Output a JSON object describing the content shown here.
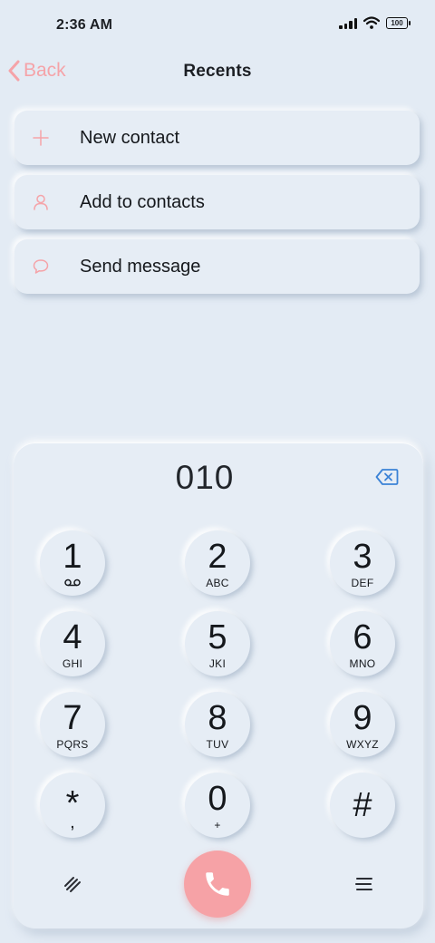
{
  "status_bar": {
    "time": "2:36 AM",
    "battery": "100"
  },
  "header": {
    "back_label": "Back",
    "title": "Recents"
  },
  "actions": [
    {
      "label": "New contact",
      "icon": "plus-icon"
    },
    {
      "label": "Add to contacts",
      "icon": "person-icon"
    },
    {
      "label": "Send message",
      "icon": "chat-bubble-icon"
    }
  ],
  "dialpad": {
    "number": "010",
    "keys": [
      {
        "digit": "1",
        "letters": ""
      },
      {
        "digit": "2",
        "letters": "ABC"
      },
      {
        "digit": "3",
        "letters": "DEF"
      },
      {
        "digit": "4",
        "letters": "GHI"
      },
      {
        "digit": "5",
        "letters": "JKI"
      },
      {
        "digit": "6",
        "letters": "MNO"
      },
      {
        "digit": "7",
        "letters": "PQRS"
      },
      {
        "digit": "8",
        "letters": "TUV"
      },
      {
        "digit": "9",
        "letters": "WXYZ"
      },
      {
        "digit": "*",
        "letters": ","
      },
      {
        "digit": "0",
        "letters": "+"
      },
      {
        "digit": "#",
        "letters": ""
      }
    ]
  },
  "colors": {
    "accent": "#f6a2a6",
    "background": "#e3ebf4"
  }
}
